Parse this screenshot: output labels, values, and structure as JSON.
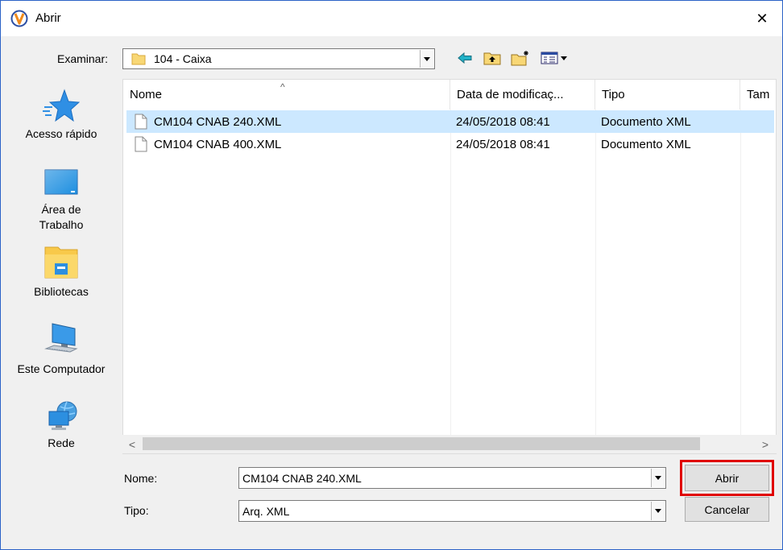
{
  "window": {
    "title": "Abrir",
    "close_glyph": "✕"
  },
  "toolbar": {
    "look_in_label": "Examinar:",
    "look_in_value": "104 - Caixa"
  },
  "places": [
    {
      "label": "Acesso rápido",
      "icon": "quick-access-star-icon"
    },
    {
      "label": "Área de Trabalho",
      "icon": "desktop-icon"
    },
    {
      "label": "Bibliotecas",
      "icon": "libraries-icon"
    },
    {
      "label": "Este Computador",
      "icon": "computer-icon"
    },
    {
      "label": "Rede",
      "icon": "network-icon"
    }
  ],
  "filelist": {
    "sort_glyph": "^",
    "columns": [
      "Nome",
      "Data de modificaç...",
      "Tipo",
      "Tam"
    ],
    "rows": [
      {
        "name": "CM104 CNAB 240.XML",
        "date": "24/05/2018 08:41",
        "type": "Documento XML",
        "selected": true
      },
      {
        "name": "CM104 CNAB 400.XML",
        "date": "24/05/2018 08:41",
        "type": "Documento XML",
        "selected": false
      }
    ],
    "scroll_left": "<",
    "scroll_right": ">"
  },
  "footer": {
    "name_label": "Nome:",
    "name_value": "CM104 CNAB 240.XML",
    "type_label": "Tipo:",
    "type_value": "Arq. XML",
    "open_button": "Abrir",
    "cancel_button": "Cancelar"
  },
  "colors": {
    "selection": "#cce8ff",
    "highlight": "#e00000",
    "border": "#2b62c7"
  }
}
